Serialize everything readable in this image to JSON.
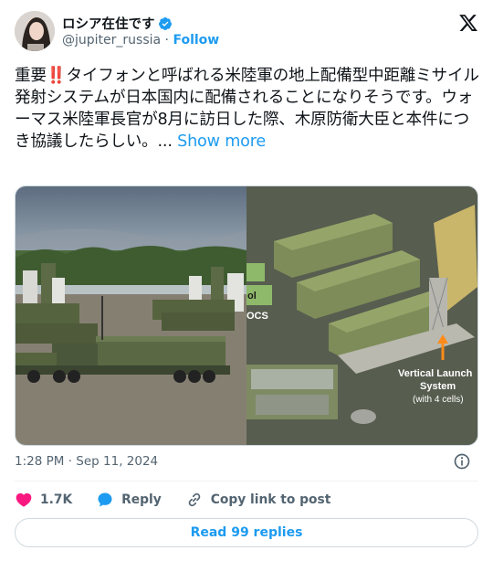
{
  "author": {
    "display_name": "ロシア在住です",
    "handle": "@jupiter_russia",
    "separator": "·",
    "follow_label": "Follow",
    "avatar_icon": "user-avatar-photo",
    "verified_icon": "verified-badge-icon",
    "verified_color": "#1d9bf0"
  },
  "brand_icon": "x-logo-icon",
  "tweet": {
    "text": "重要‼️タイフォンと呼ばれる米陸軍の地上配備型中距離ミサイル発射システムが日本国内に配備されることになりそうです。ウォーマス米陸軍長官が8月に訪日した際、木原防衛大臣と本件につき協議したらしい。... ",
    "show_more": "Show more"
  },
  "media": {
    "right_photo_labels": {
      "label_ol": "ol",
      "label_ocs": "OCS",
      "vls_line1": "Vertical Launch",
      "vls_line2": "System",
      "vls_line3": "(with 4 cells)"
    }
  },
  "timestamp": {
    "time": "1:28 PM",
    "separator": "·",
    "date": "Sep 11, 2024"
  },
  "actions": {
    "like_count": "1.7K",
    "reply_label": "Reply",
    "copy_link_label": "Copy link to post"
  },
  "read_replies": "Read 99 replies",
  "colors": {
    "accent": "#1d9bf0",
    "like": "#f91880",
    "text_secondary": "#536471"
  }
}
